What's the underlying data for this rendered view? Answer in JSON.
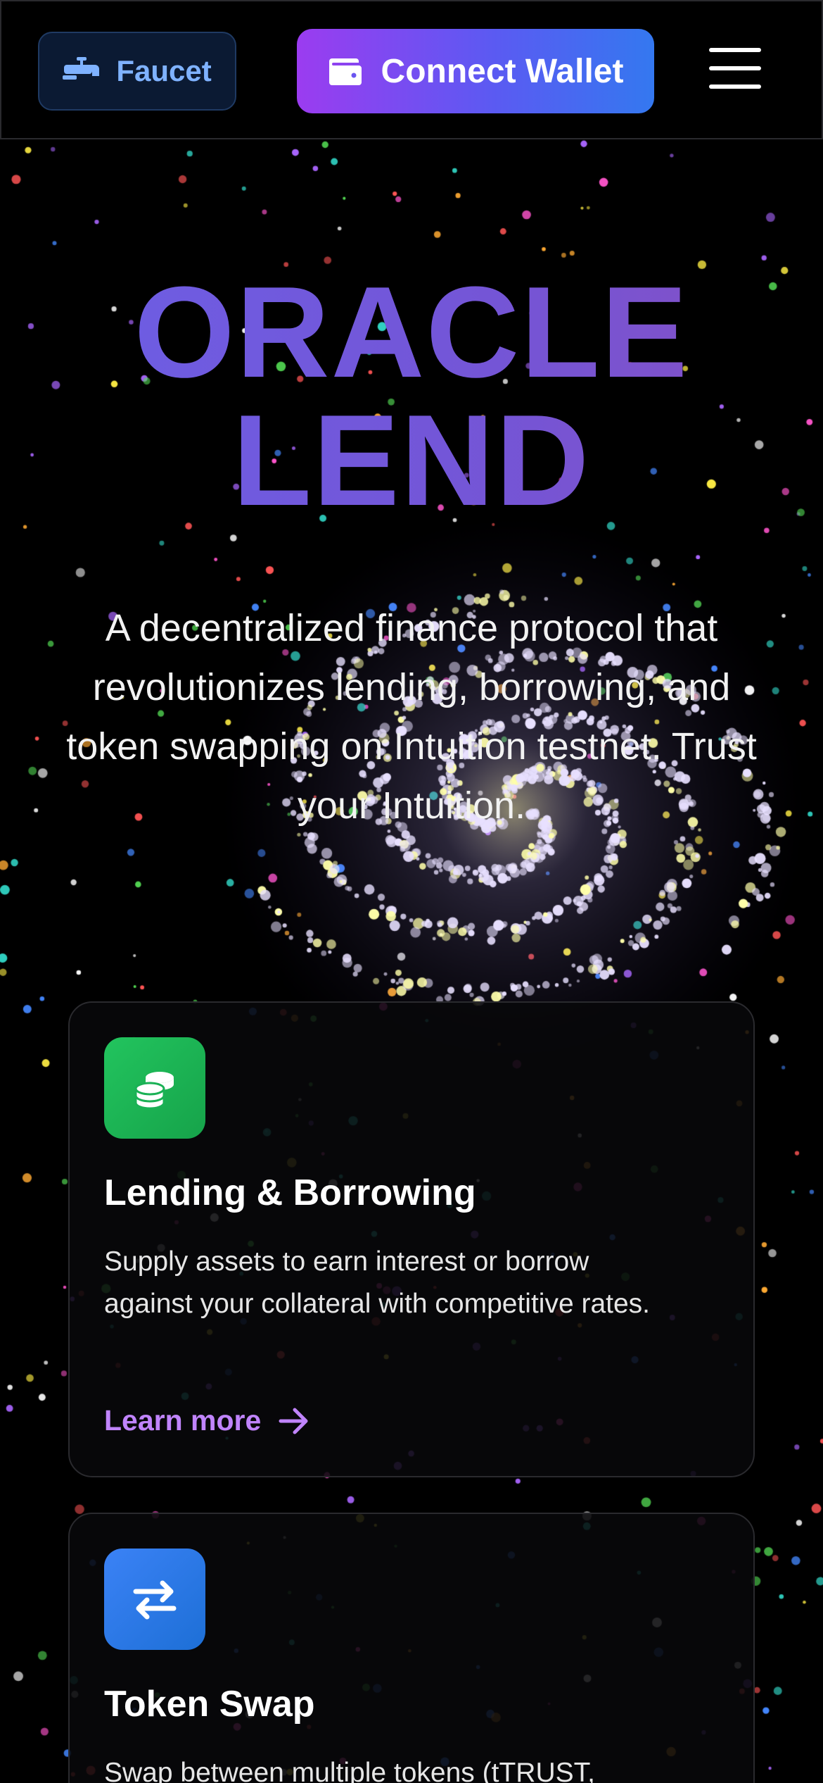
{
  "header": {
    "faucet_label": "Faucet",
    "connect_wallet_label": "Connect Wallet"
  },
  "hero": {
    "title_line1": "ORACLE",
    "title_line2": "LEND",
    "subtitle": "A decentralized finance protocol that revolutionizes lending, borrowing, and token swapping on Intuition testnet. Trust your Intuition."
  },
  "features": [
    {
      "title": "Lending & Borrowing",
      "description": "Supply assets to earn interest or borrow against your collateral with competitive rates.",
      "link_label": "Learn more",
      "icon": "coins-icon",
      "color": "#22c45e"
    },
    {
      "title": "Token Swap",
      "description": "Swap between multiple tokens (tTRUST,",
      "icon": "swap-arrows-icon",
      "color": "#3b82f6"
    }
  ],
  "colors": {
    "accent_purple": "#c084fc",
    "wallet_gradient_start": "#9b3cf0",
    "wallet_gradient_end": "#3478f0",
    "faucet_text": "#7fb2ff"
  }
}
